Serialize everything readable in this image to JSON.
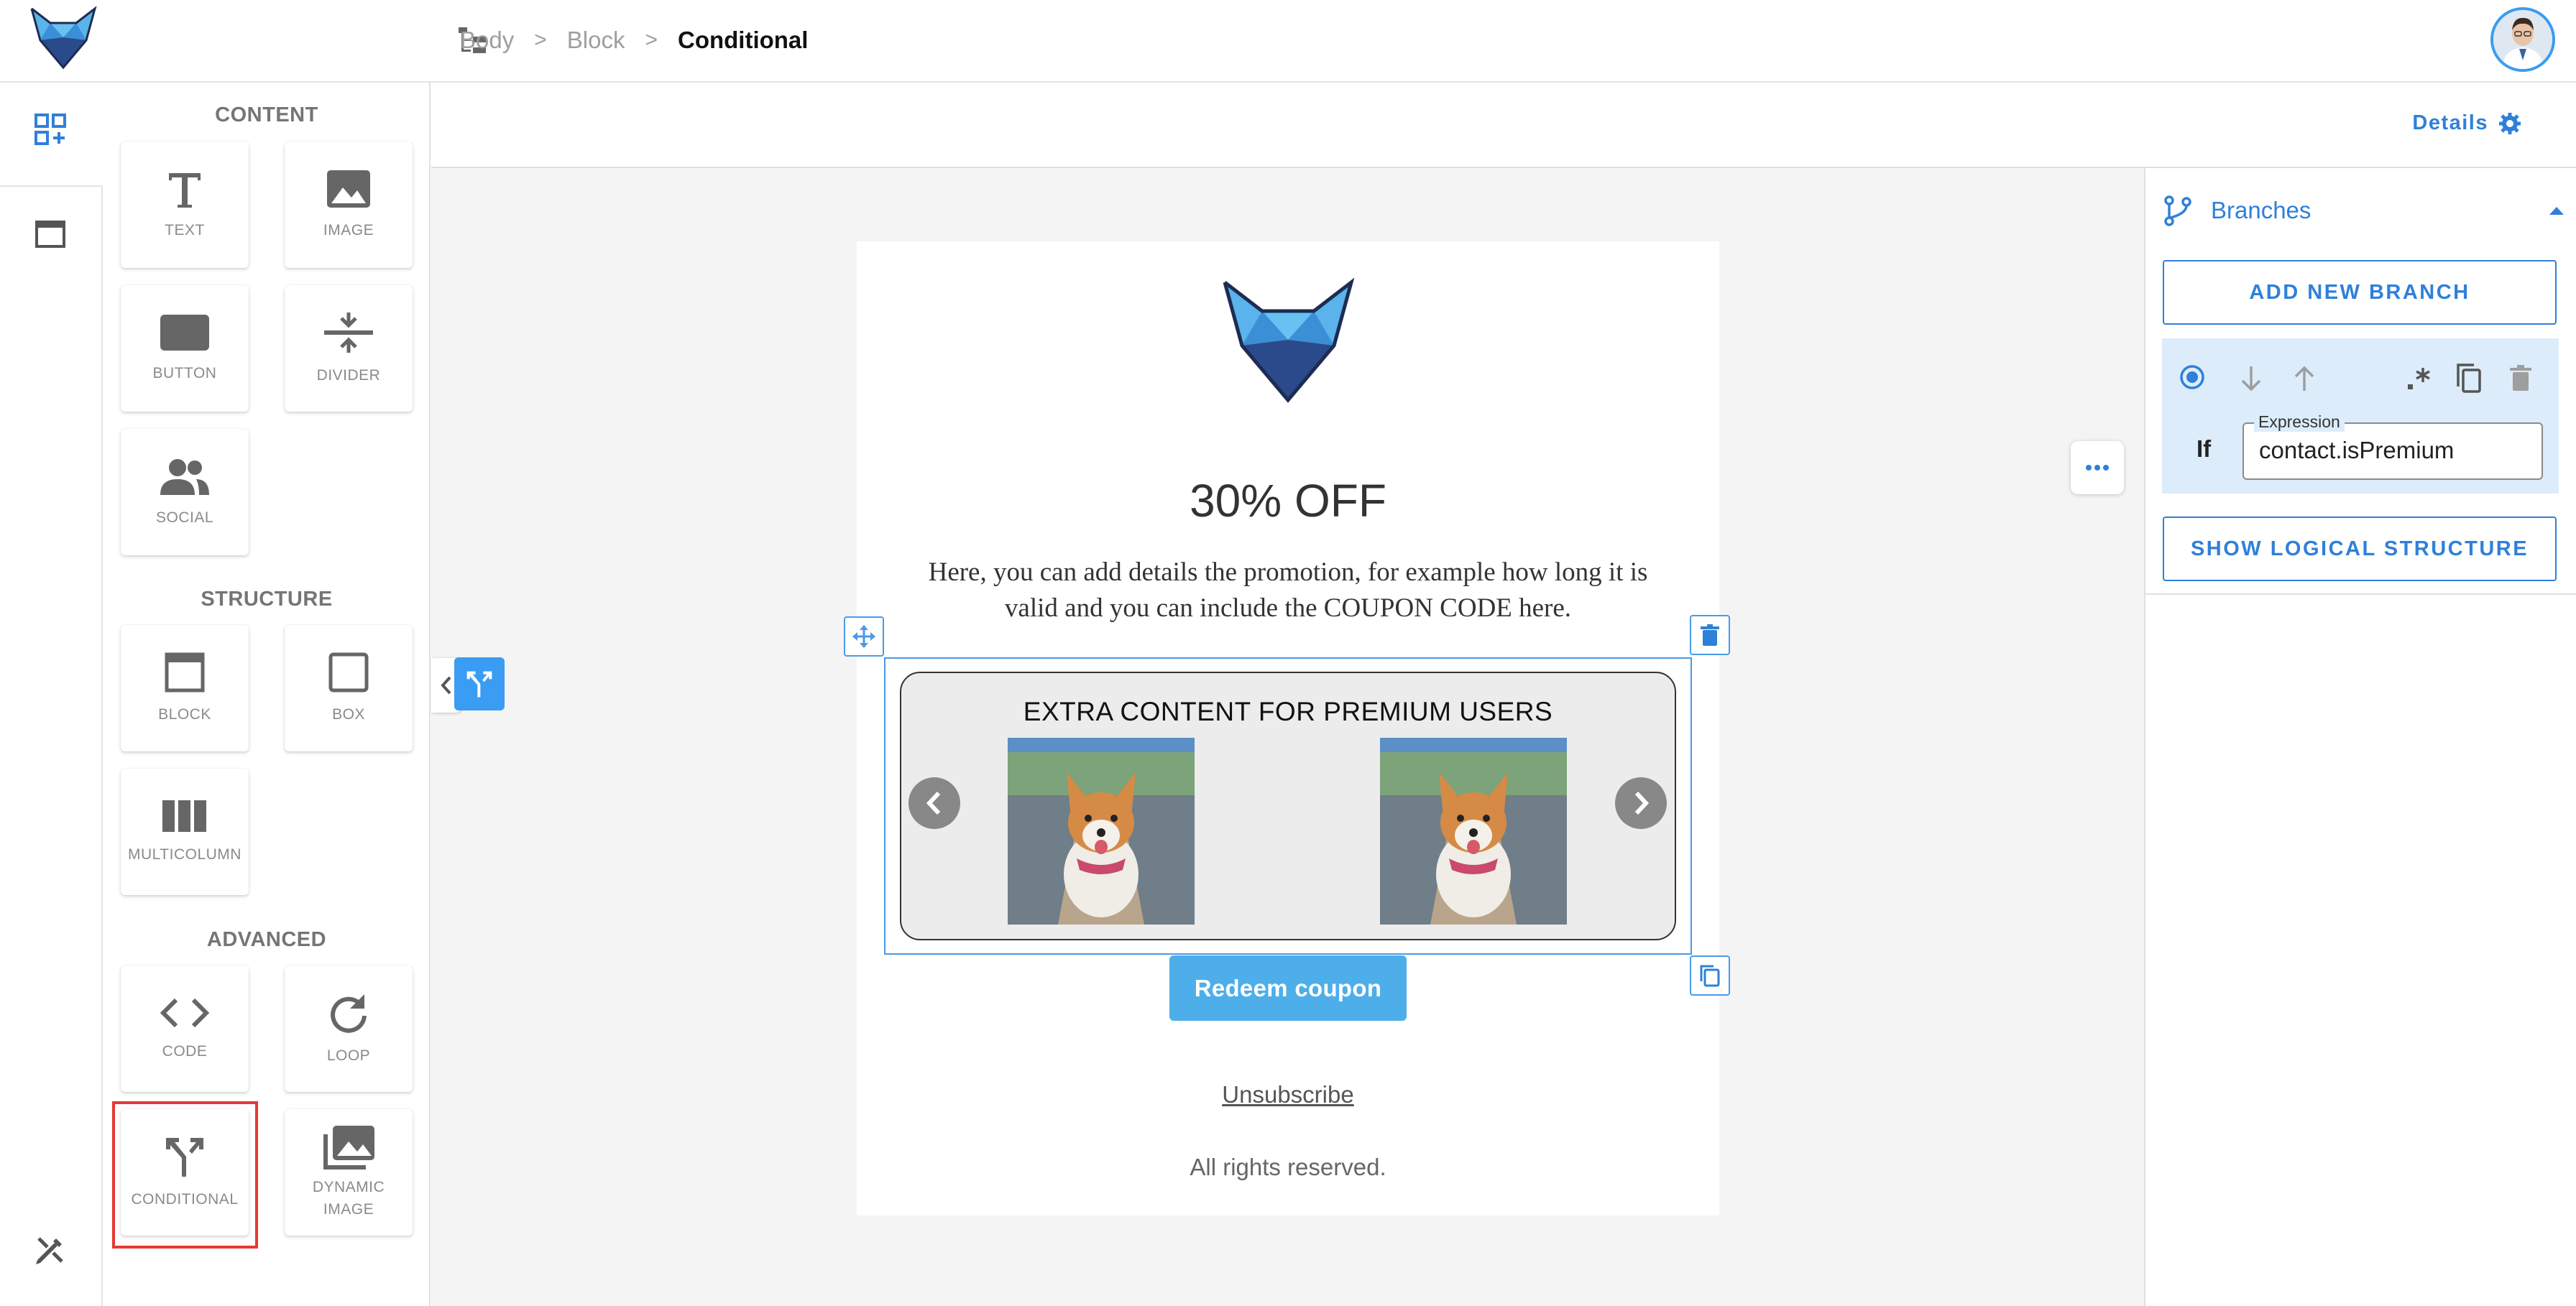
{
  "breadcrumb": [
    "Body",
    "Block",
    "Conditional"
  ],
  "breadcrumb_separator": ">",
  "palette": {
    "content_title": "CONTENT",
    "structure_title": "STRUCTURE",
    "advanced_title": "ADVANCED",
    "tiles": {
      "text": "TEXT",
      "image": "IMAGE",
      "button": "BUTTON",
      "divider": "DIVIDER",
      "social": "SOCIAL",
      "block": "BLOCK",
      "box": "BOX",
      "multicolumn": "MULTICOLUMN",
      "code": "CODE",
      "loop": "LOOP",
      "conditional": "CONDITIONAL",
      "dynamic_image_1": "DYNAMIC",
      "dynamic_image_2": "IMAGE"
    }
  },
  "canvas": {
    "details_label": "Details"
  },
  "email": {
    "title": "30% OFF",
    "body_line1": "Here, you can add details  the promotion, for example how long it is",
    "body_line2": "valid and you can include the COUPON CODE here.",
    "premium_text": "EXTRA CONTENT FOR PREMIUM USERS",
    "redeem_label": "Redeem coupon",
    "unsubscribe_label": "Unsubscribe",
    "rights_text": "All rights reserved."
  },
  "right_panel": {
    "branches_title": "Branches",
    "add_branch_label": "ADD NEW BRANCH",
    "if_label": "If",
    "expression_label": "Expression",
    "expression_value": "contact.isPremium",
    "show_structure_label": "SHOW LOGICAL STRUCTURE"
  },
  "colors": {
    "accent": "#2f80d9",
    "redeem": "#4eaeea",
    "branch_card": "#ddecfb",
    "selection_highlight": "#e53935"
  }
}
